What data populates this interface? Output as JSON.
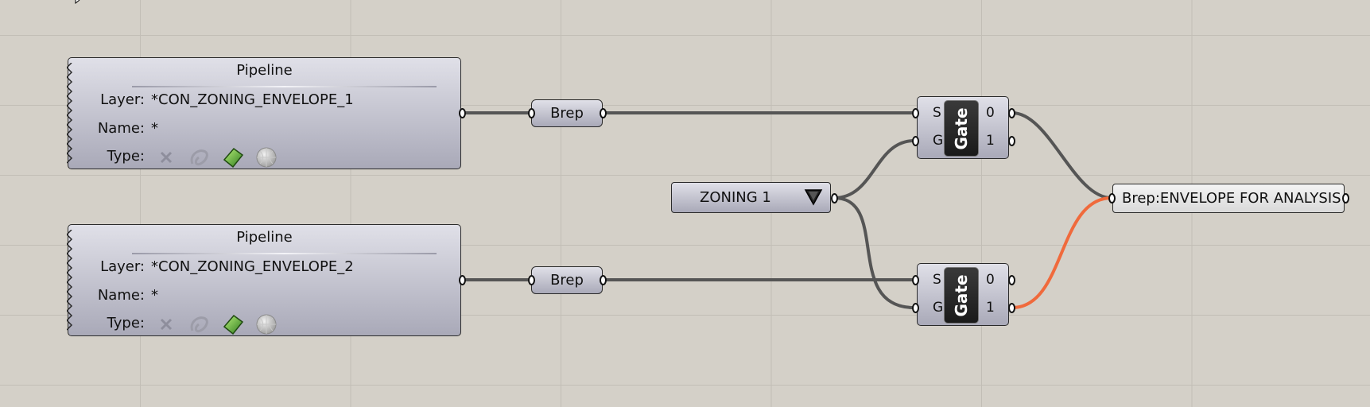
{
  "pipelines": [
    {
      "title": "Pipeline",
      "layer_label": "Layer:",
      "layer_value": "*CON_ZONING_ENVELOPE_1",
      "name_label": "Name:",
      "name_value": "*",
      "type_label": "Type:"
    },
    {
      "title": "Pipeline",
      "layer_label": "Layer:",
      "layer_value": "*CON_ZONING_ENVELOPE_2",
      "name_label": "Name:",
      "name_value": "*",
      "type_label": "Type:"
    }
  ],
  "type_icons": [
    "point-x-icon",
    "curve-icon",
    "brep-icon",
    "mesh-icon"
  ],
  "brep_params": [
    {
      "label": "Brep"
    },
    {
      "label": "Brep"
    }
  ],
  "gates": [
    {
      "label": "Gate",
      "inputs": [
        "S",
        "G"
      ],
      "outputs": [
        "0",
        "1"
      ]
    },
    {
      "label": "Gate",
      "inputs": [
        "S",
        "G"
      ],
      "outputs": [
        "0",
        "1"
      ]
    }
  ],
  "value_list": {
    "selected": "ZONING 1"
  },
  "output_param": {
    "label": "Brep:ENVELOPE FOR ANALYSIS"
  },
  "colors": {
    "canvas": "#d4d0c8",
    "wire": "#555555",
    "active_wire": "#f06a3c"
  }
}
